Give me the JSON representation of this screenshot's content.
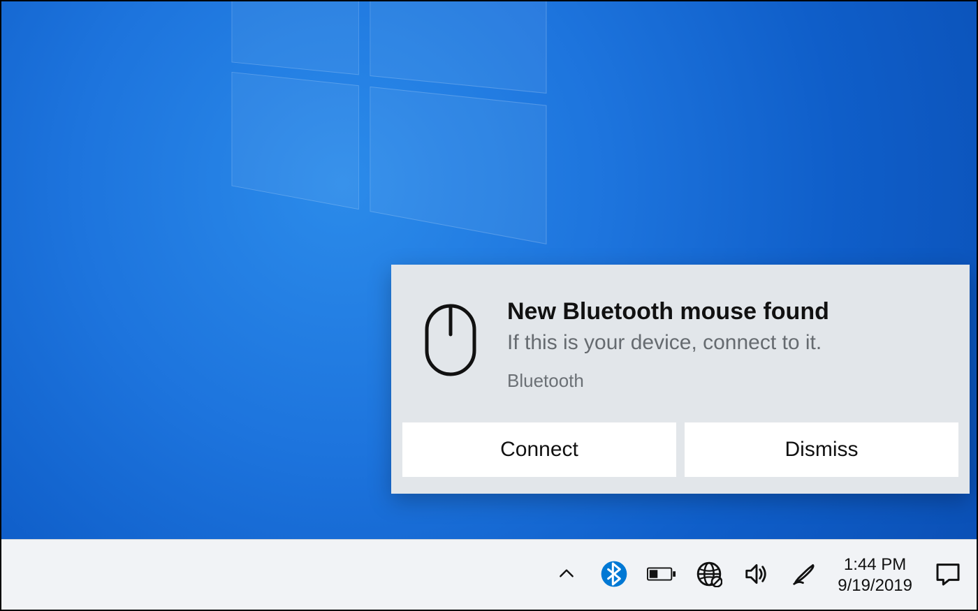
{
  "notification": {
    "title": "New Bluetooth mouse found",
    "subtitle": "If this is your device, connect to it.",
    "source": "Bluetooth",
    "icon": "mouse-icon",
    "actions": {
      "connect_label": "Connect",
      "dismiss_label": "Dismiss"
    }
  },
  "taskbar": {
    "clock": {
      "time": "1:44 PM",
      "date": "9/19/2019"
    },
    "tray_icons": [
      "chevron-up-icon",
      "bluetooth-icon",
      "battery-icon",
      "globe-network-icon",
      "volume-icon",
      "pen-icon"
    ]
  },
  "colors": {
    "toast_bg": "#e2e6ea",
    "taskbar_bg": "#f1f3f6",
    "bluetooth_accent": "#0078d4"
  }
}
